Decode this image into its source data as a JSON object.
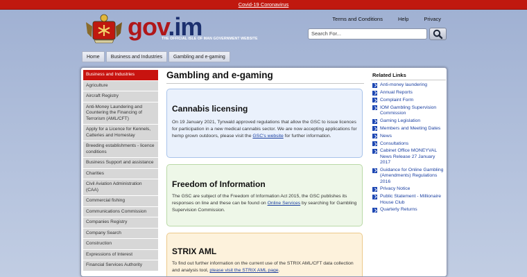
{
  "banner": {
    "text": "Covid-19 Coronavirus",
    "color": "#c0180f"
  },
  "brand": {
    "name_a": "gov",
    "name_b": ".im",
    "tagline": "THE OFFICIAL ISLE OF MAN GOVERNMENT WEBSITE"
  },
  "header": {
    "links": [
      "Terms and Conditions",
      "Help",
      "Privacy"
    ],
    "search_placeholder": "Search For...",
    "search_icon": "magnifier-icon"
  },
  "breadcrumbs": [
    "Home",
    "Business and Industries",
    "Gambling and e-gaming"
  ],
  "left_nav": {
    "items": [
      "Business and Industries",
      "Agriculture",
      "Aircraft Registry",
      "Anti-Money Laundering and Countering the Financing of Terrorism (AML/CFT)",
      "Apply for a Licence for Kennels, Catteries and Homestay",
      "Breeding establishments - licence conditions",
      "Business Support and assistance",
      "Charities",
      "Civil Aviation Administration (CAA)",
      "Commercial fishing",
      "Communications Commission",
      "Companies Registry",
      "Company Search",
      "Construction",
      "Expressions of Interest",
      "Financial Services Authority"
    ]
  },
  "main": {
    "title": "Gambling and e-gaming",
    "cards": [
      {
        "heading": "Cannabis licensing",
        "text": "On 19 January 2021, Tynwald approved regulations that allow the GSC to issue licences for participation in a new medical cannabis sector. We are now accepting applications for hemp grown outdoors, please visit the ",
        "link": "GSC's website",
        "text_after": " for further information."
      },
      {
        "heading": "Freedom of Information",
        "text": "The GSC are subject of the Freedom of Information Act 2015, the GSC publishes its responses on line and these can be found on ",
        "link": "Online Services",
        "text_after": " by searching for Gambling Supervision Commission."
      },
      {
        "heading": "STRIX AML",
        "text": "To find out further information on the current use of the STRIX AML/CFT data collection and analysis tool, ",
        "link": "please visit the STRIX AML page",
        "text_after": "."
      }
    ]
  },
  "related_links": {
    "title": "Related Links",
    "items": [
      "Anti-money laundering",
      "Annual Reports",
      "Complaint Form",
      "IOM Gambling Supervision Commission",
      "Gaming Legislation",
      "Members and Meeting Dates",
      "News",
      "Consultations",
      "Cabinet Office MONEYVAL News Release 27 January 2017",
      "Guidance for Online Gambling (Amendments) Regulations 2016",
      "Privacy Notice",
      "Public Statement - Millionaire House Club",
      "Quarterly Returns"
    ]
  },
  "colors": {
    "accent_red": "#c8130f",
    "brand_blue": "#1b2f6e",
    "link_blue": "#1a3fa0"
  }
}
